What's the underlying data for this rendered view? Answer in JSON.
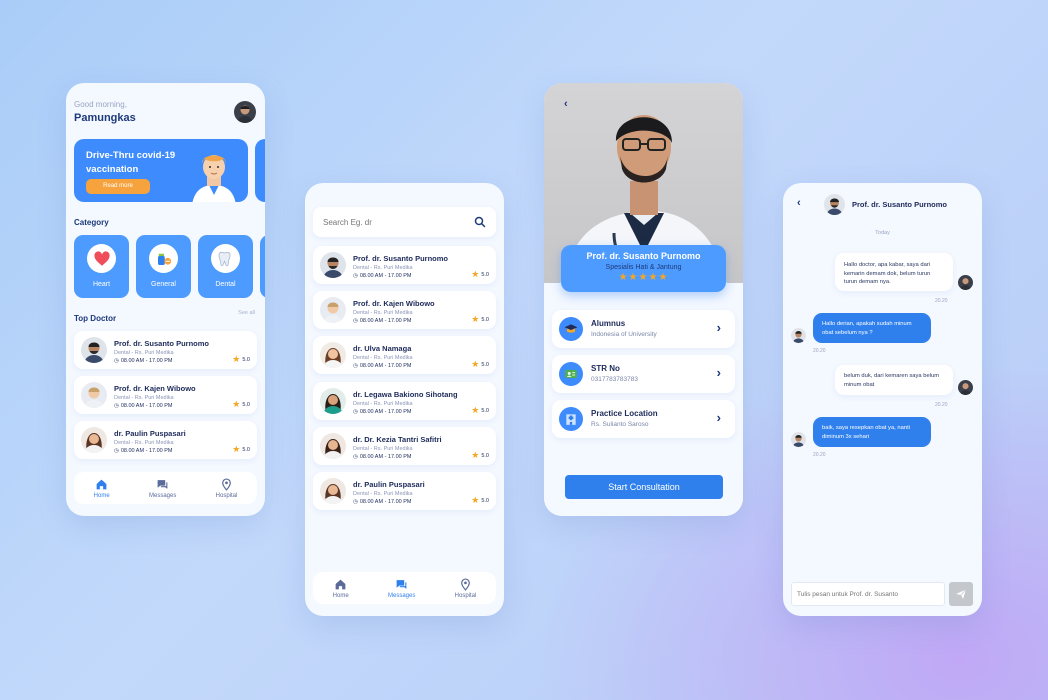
{
  "colors": {
    "primary": "#2f80ed",
    "light_blue": "#4d9bff",
    "bg": "#f4f8ff",
    "star": "#f5a623"
  },
  "home": {
    "greeting": "Good morning,",
    "username": "Pamungkas",
    "banner": {
      "title": "Drive-Thru covid-19 vaccination",
      "button": "Read more"
    },
    "category_title": "Category",
    "categories": [
      {
        "label": "Heart",
        "icon": "heart-icon"
      },
      {
        "label": "General",
        "icon": "pills-icon"
      },
      {
        "label": "Dental",
        "icon": "tooth-icon"
      }
    ],
    "top_doctor_title": "Top Doctor",
    "see_all": "See all",
    "doctors": [
      {
        "name": "Prof. dr. Susanto Purnomo",
        "sub": "Dental - Rs. Puri Medika",
        "time": "08.00 AM - 17.00 PM",
        "rating": "5.0"
      },
      {
        "name": "Prof. dr. Kajen Wibowo",
        "sub": "Dental - Rs. Puri Medika",
        "time": "08.00 AM - 17.00 PM",
        "rating": "5.0"
      },
      {
        "name": "dr. Paulin Puspasari",
        "sub": "Dental - Rs. Puri Medika",
        "time": "08.00 AM - 17.00 PM",
        "rating": "5.0"
      }
    ]
  },
  "nav": {
    "home": "Home",
    "messages": "Messages",
    "hospital": "Hospital"
  },
  "search": {
    "placeholder": "Search Eg. dr",
    "doctors": [
      {
        "name": "Prof. dr. Susanto Purnomo",
        "sub": "Dental - Rs. Puri Medika",
        "time": "08.00 AM - 17.00 PM",
        "rating": "5.0"
      },
      {
        "name": "Prof. dr. Kajen Wibowo",
        "sub": "Dental - Rs. Puri Medika",
        "time": "08.00 AM - 17.00 PM",
        "rating": "5.0"
      },
      {
        "name": "dr. Ulva Namaga",
        "sub": "Dental - Rs. Puri Medika",
        "time": "08.00 AM - 17.00 PM",
        "rating": "5.0"
      },
      {
        "name": "dr. Legawa Bakiono Sihotang",
        "sub": "Dental - Rs. Puri Medika",
        "time": "08.00 AM - 17.00 PM",
        "rating": "5.0"
      },
      {
        "name": "dr. Dr. Kezia Tantri Safitri",
        "sub": "Dental - Rs. Puri Medika",
        "time": "08.00 AM - 17.00 PM",
        "rating": "5.0"
      },
      {
        "name": "dr. Paulin Puspasari",
        "sub": "Dental - Rs. Puri Medika",
        "time": "08.00 AM - 17.00 PM",
        "rating": "5.0"
      }
    ]
  },
  "detail": {
    "name": "Prof. dr. Susanto Purnomo",
    "specialty": "Spesialis Hati & Jantung",
    "stars": 5,
    "info": [
      {
        "title": "Alumnus",
        "value": "Indonesia of University",
        "icon": "graduation-cap-icon"
      },
      {
        "title": "STR No",
        "value": "0317783783783",
        "icon": "id-card-icon"
      },
      {
        "title": "Practice Location",
        "value": "Rs. Sulianto Saroso",
        "icon": "hospital-icon"
      }
    ],
    "button": "Start Consultation"
  },
  "chat": {
    "name": "Prof. dr. Susanto Purnomo",
    "day": "Today",
    "messages": [
      {
        "from": "me",
        "text": "Hallo doctor, apa kabar, saya dari kemarin demam dok, belum turun turun demam nya.",
        "time": "20.20"
      },
      {
        "from": "doc",
        "text": "Hallo derian, apakah sudah minum obat sebelum nya ?",
        "time": "20.20"
      },
      {
        "from": "me",
        "text": "belum duk, dari kemaren saya belum minum obat",
        "time": "20.20"
      },
      {
        "from": "doc",
        "text": "baik, saya resepkan obat ya, nanti diminum 3x sehari",
        "time": "20.20"
      }
    ],
    "input_placeholder": "Tulis pesan untuk Prof. dr. Susanto"
  }
}
